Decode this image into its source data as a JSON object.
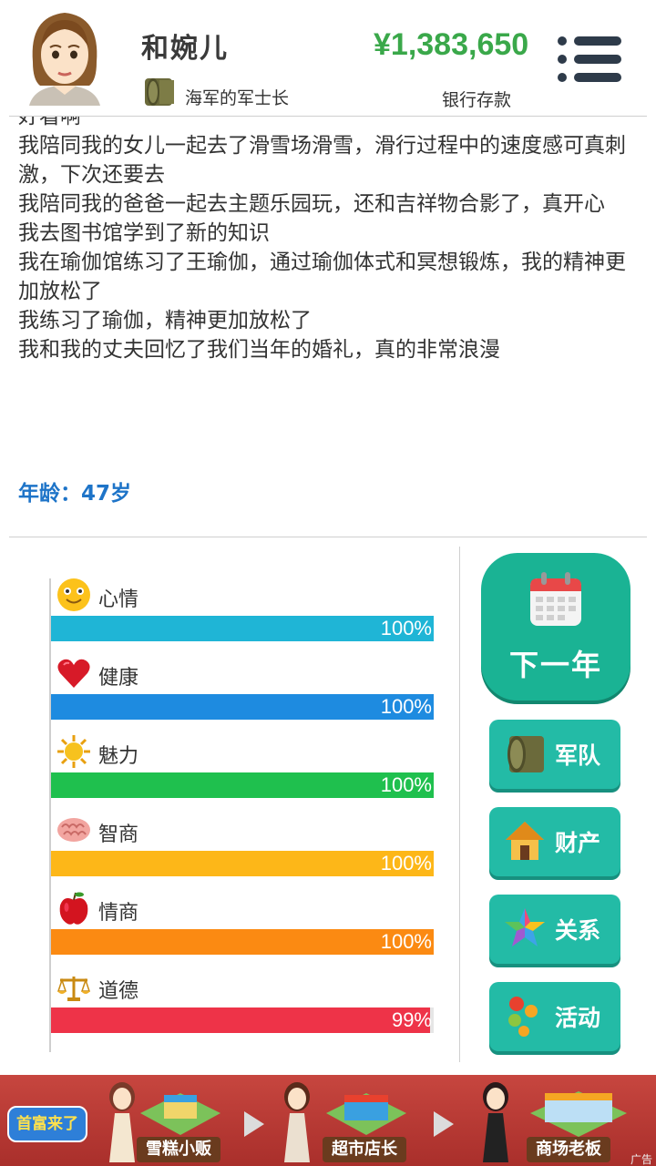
{
  "header": {
    "player_name": "和婉儿",
    "rank_title": "海军的军士长",
    "money": "¥1,383,650",
    "bank_label": "银行存款"
  },
  "log": {
    "cut_line": "好看啊",
    "lines": [
      "我陪同我的女儿一起去了滑雪场滑雪，滑行过程中的速度感可真刺激，下次还要去",
      "我陪同我的爸爸一起去主题乐园玩，还和吉祥物合影了，真开心",
      "我去图书馆学到了新的知识",
      "我在瑜伽馆练习了王瑜伽，通过瑜伽体式和冥想锻炼，我的精神更加放松了",
      "我练习了瑜伽，精神更加放松了",
      "我和我的丈夫回忆了我们当年的婚礼，真的非常浪漫"
    ]
  },
  "age": "年龄：47岁",
  "stats": [
    {
      "label": "心情",
      "value": 100,
      "display": "100%",
      "color": "#1fb5d6",
      "icon": "smiley-icon"
    },
    {
      "label": "健康",
      "value": 100,
      "display": "100%",
      "color": "#1e8be0",
      "icon": "heart-icon"
    },
    {
      "label": "魅力",
      "value": 100,
      "display": "100%",
      "color": "#1fc04e",
      "icon": "sun-icon"
    },
    {
      "label": "智商",
      "value": 100,
      "display": "100%",
      "color": "#fdb718",
      "icon": "brain-icon"
    },
    {
      "label": "情商",
      "value": 100,
      "display": "100%",
      "color": "#fb8a12",
      "icon": "apple-icon"
    },
    {
      "label": "道德",
      "value": 99,
      "display": "99%",
      "color": "#ee3348",
      "icon": "scale-icon"
    }
  ],
  "buttons": {
    "next_year": "下一年",
    "army": "军队",
    "assets": "财产",
    "relations": "关系",
    "activities": "活动"
  },
  "ad": {
    "brand": "首富来了",
    "stage1": "雪糕小贩",
    "stage2": "超市店长",
    "stage3": "商场老板",
    "tag": "广告"
  }
}
